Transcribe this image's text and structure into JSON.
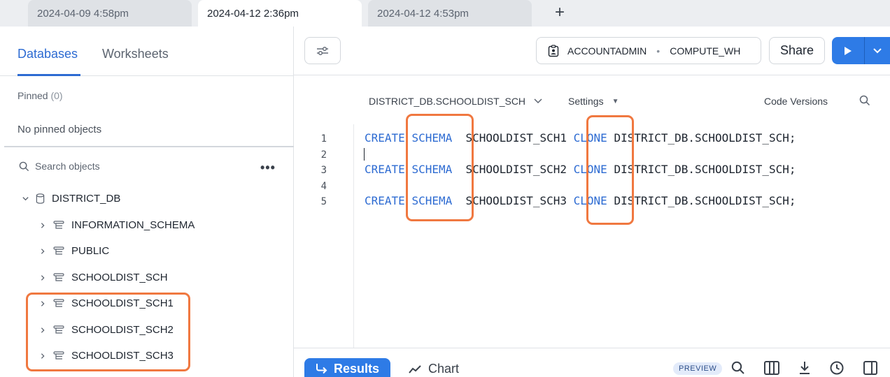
{
  "tabs": [
    {
      "label": "2024-04-09 4:58pm",
      "active": false
    },
    {
      "label": "2024-04-12 2:36pm",
      "active": true
    },
    {
      "label": "2024-04-12 4:53pm",
      "active": false
    }
  ],
  "tab_add": "+",
  "sidebar": {
    "tabs": [
      {
        "label": "Databases",
        "active": true
      },
      {
        "label": "Worksheets",
        "active": false
      }
    ],
    "pinned_label": "Pinned",
    "pinned_count": "(0)",
    "no_pinned": "No pinned objects",
    "search_placeholder": "Search objects",
    "more": "•••",
    "tree": {
      "database": "DISTRICT_DB",
      "schemas": [
        "INFORMATION_SCHEMA",
        "PUBLIC",
        "SCHOOLDIST_SCH",
        "SCHOOLDIST_SCH1",
        "SCHOOLDIST_SCH2",
        "SCHOOLDIST_SCH3"
      ]
    }
  },
  "toolbar": {
    "role": "ACCOUNTADMIN",
    "separator": "•",
    "warehouse": "COMPUTE_WH",
    "share_label": "Share"
  },
  "editor": {
    "context": "DISTRICT_DB.SCHOOLDIST_SCH",
    "settings_label": "Settings",
    "code_versions_label": "Code Versions",
    "lines": [
      {
        "num": "1",
        "kw1": "CREATE",
        "kw2": "SCHEMA",
        "name": "SCHOOLDIST_SCH1",
        "kw3": "CLONE",
        "src": "DISTRICT_DB.SCHOOLDIST_SCH;"
      },
      {
        "num": "2"
      },
      {
        "num": "3",
        "kw1": "CREATE",
        "kw2": "SCHEMA",
        "name": "SCHOOLDIST_SCH2",
        "kw3": "CLONE",
        "src": "DISTRICT_DB.SCHOOLDIST_SCH;"
      },
      {
        "num": "4"
      },
      {
        "num": "5",
        "kw1": "CREATE",
        "kw2": "SCHEMA",
        "name": "SCHOOLDIST_SCH3",
        "kw3": "CLONE",
        "src": "DISTRICT_DB.SCHOOLDIST_SCH;"
      }
    ]
  },
  "results": {
    "results_label": "Results",
    "chart_label": "Chart",
    "preview_badge": "PREVIEW"
  },
  "colors": {
    "accent": "#2e7be6",
    "keyword": "#2d6bd2",
    "highlight": "#f07840"
  }
}
